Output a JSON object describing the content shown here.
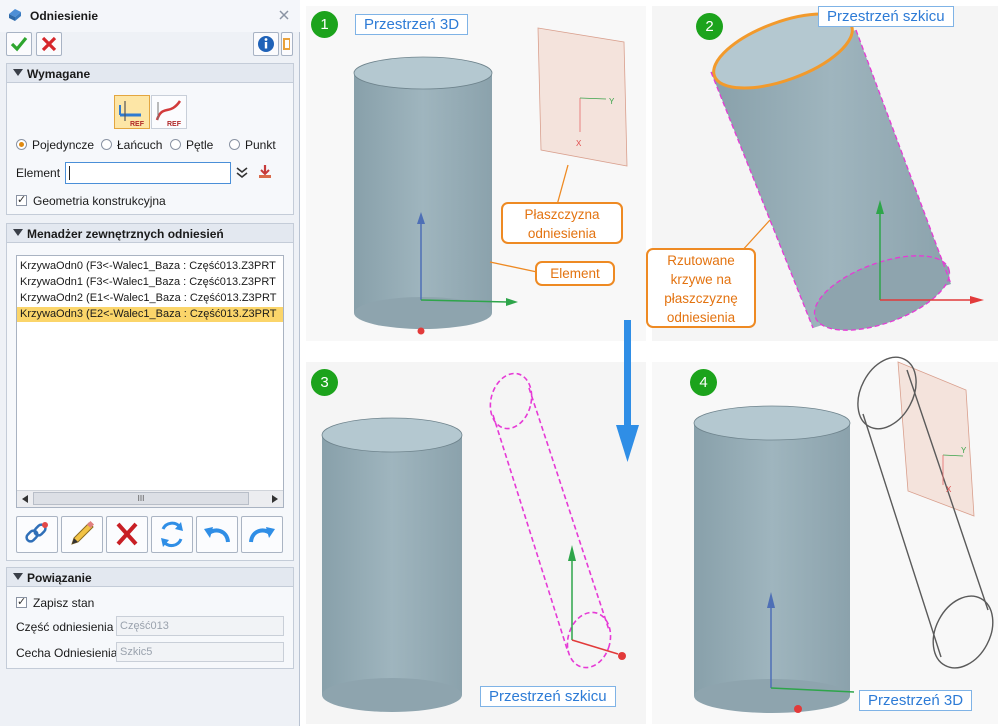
{
  "dialog": {
    "title": "Odniesienie",
    "sections": {
      "required": "Wymagane",
      "manager": "Menadżer zewnętrznych odniesień",
      "binding": "Powiązanie"
    },
    "mode_options": [
      {
        "label": "Pojedyncze",
        "selected": true
      },
      {
        "label": "Łańcuch",
        "selected": false
      },
      {
        "label": "Pętle",
        "selected": false
      },
      {
        "label": "Punkt",
        "selected": false
      }
    ],
    "element_label": "Element",
    "element_value": "",
    "construction_geometry_label": "Geometria konstrukcyjna",
    "construction_geometry_checked": true,
    "reference_list": [
      "KrzywaOdn0  (F3<-Walec1_Baza : Część013.Z3PRT",
      "KrzywaOdn1  (F3<-Walec1_Baza : Część013.Z3PRT",
      "KrzywaOdn2  (E1<-Walec1_Baza : Część013.Z3PRT",
      "KrzywaOdn3  (E2<-Walec1_Baza : Część013.Z3PRT"
    ],
    "selected_reference": "KrzywaOdn3  (E2<-Walec1_Baza : Część013.Z3PRT",
    "save_state_label": "Zapisz stan",
    "save_state_checked": true,
    "ref_part_label": "Część odniesienia",
    "ref_part_value": "Część013",
    "ref_feature_label": "Cecha Odniesienia",
    "ref_feature_value": "Szkic5",
    "ref_icon_text": "REF",
    "scroll_thumb": "III"
  },
  "viewport": {
    "steps": [
      "1",
      "2",
      "3",
      "4"
    ],
    "labels": {
      "space_3d": "Przestrzeń 3D",
      "space_sketch": "Przestrzeń szkicu"
    },
    "callouts": {
      "plane": [
        "Płaszczyzna",
        "odniesienia"
      ],
      "element": "Element",
      "projected": [
        "Rzutowane",
        "krzywe na",
        "płaszczyznę",
        "odniesienia"
      ]
    },
    "axis_x": "X",
    "axis_y": "Y",
    "colors": {
      "cylinder": "#9fb4bd",
      "cylinder_top": "#b2c6ce",
      "projected_curve": "#e63ad6",
      "edge_highlight": "#f29a2c",
      "callout_border": "#ee8a23",
      "label_text": "#2d7bd6",
      "step_badge": "#1ca31c",
      "arrow": "#2f8ee6"
    }
  }
}
